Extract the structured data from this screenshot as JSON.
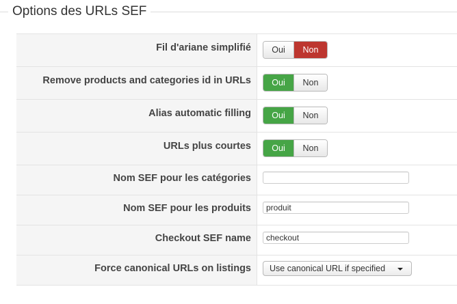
{
  "legend": "Options des URLs SEF",
  "rows": [
    {
      "label": "Fil d'ariane simplifié",
      "type": "toggle",
      "oui": "Oui",
      "non": "Non",
      "selected": "Non"
    },
    {
      "label": "Remove products and categories id in URLs",
      "type": "toggle",
      "oui": "Oui",
      "non": "Non",
      "selected": "Oui"
    },
    {
      "label": "Alias automatic filling",
      "type": "toggle",
      "oui": "Oui",
      "non": "Non",
      "selected": "Oui"
    },
    {
      "label": "URLs plus courtes",
      "type": "toggle",
      "oui": "Oui",
      "non": "Non",
      "selected": "Oui"
    },
    {
      "label": "Nom SEF pour les catégories",
      "type": "text",
      "value": ""
    },
    {
      "label": "Nom SEF pour les produits",
      "type": "text",
      "value": "produit"
    },
    {
      "label": "Checkout SEF name",
      "type": "text",
      "value": "checkout"
    },
    {
      "label": "Force canonical URLs on listings",
      "type": "select",
      "value": "Use canonical URL if specified"
    }
  ],
  "colors": {
    "oui_active": "#46a546",
    "non_active": "#bd362f"
  }
}
